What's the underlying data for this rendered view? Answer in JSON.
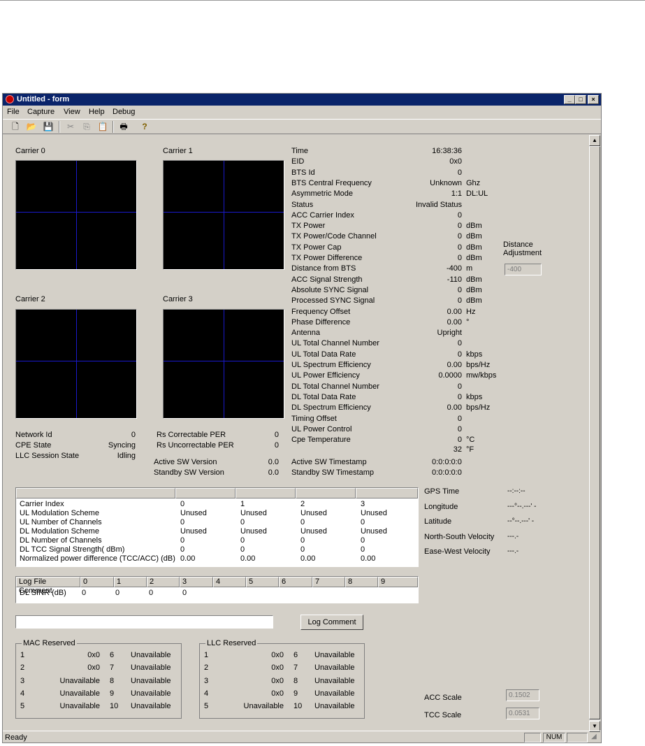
{
  "window": {
    "title": "Untitled - form",
    "min_glyph": "_",
    "max_glyph": "□",
    "close_glyph": "×"
  },
  "menu": {
    "items": [
      "File",
      "Capture",
      "View",
      "Help",
      "Debug"
    ]
  },
  "toolbar": {
    "icons": [
      "new-icon",
      "open-icon",
      "save-icon",
      "cut-icon",
      "copy-icon",
      "paste-icon",
      "print-icon",
      "help-icon"
    ],
    "glyphs": [
      "🗋",
      "📂",
      "💾",
      "✂",
      "⎘",
      "📋",
      "🖶",
      "?"
    ]
  },
  "carriers": [
    "Carrier 0",
    "Carrier 1",
    "Carrier 2",
    "Carrier 3"
  ],
  "left_info": [
    {
      "label": "Network Id",
      "value": "0"
    },
    {
      "label": "CPE State",
      "value": "Syncing"
    },
    {
      "label": "LLC Session State",
      "value": "Idling"
    }
  ],
  "mid_info": [
    {
      "label": "Rs Correctable PER",
      "value": "0"
    },
    {
      "label": "Rs Uncorrectable PER",
      "value": "0"
    }
  ],
  "sw": [
    {
      "label": "Active SW Version",
      "value": "0.0"
    },
    {
      "label": "Standby SW Version",
      "value": "0.0"
    }
  ],
  "stats": [
    {
      "label": "Time",
      "value": "16:38:36",
      "unit": ""
    },
    {
      "label": "EID",
      "value": "0x0",
      "unit": ""
    },
    {
      "label": "BTS Id",
      "value": "0",
      "unit": ""
    },
    {
      "label": "BTS Central Frequency",
      "value": "Unknown",
      "unit": "Ghz"
    },
    {
      "label": "Asymmetric Mode",
      "value": "1:1",
      "unit": "DL:UL"
    },
    {
      "label": "Status",
      "value": "Invalid Status",
      "unit": ""
    },
    {
      "label": "ACC Carrier Index",
      "value": "0",
      "unit": ""
    },
    {
      "label": "TX Power",
      "value": "0",
      "unit": "dBm"
    },
    {
      "label": "TX Power/Code Channel",
      "value": "0",
      "unit": "dBm"
    },
    {
      "label": "TX Power Cap",
      "value": "0",
      "unit": "dBm"
    },
    {
      "label": "TX Power Difference",
      "value": "0",
      "unit": "dBm"
    },
    {
      "label": "Distance from BTS",
      "value": "-400",
      "unit": "m"
    },
    {
      "label": "ACC Signal Strength",
      "value": "-110",
      "unit": "dBm"
    },
    {
      "label": "Absolute SYNC Signal",
      "value": "0",
      "unit": "dBm"
    },
    {
      "label": "Processed SYNC Signal",
      "value": "0",
      "unit": "dBm"
    },
    {
      "label": "Frequency Offset",
      "value": "0.00",
      "unit": "Hz"
    },
    {
      "label": "Phase Difference",
      "value": "0.00",
      "unit": "°"
    },
    {
      "label": "Antenna",
      "value": "Upright",
      "unit": ""
    },
    {
      "label": "UL Total Channel Number",
      "value": "0",
      "unit": ""
    },
    {
      "label": "UL Total Data Rate",
      "value": "0",
      "unit": "kbps"
    },
    {
      "label": "UL Spectrum Efficiency",
      "value": "0.00",
      "unit": "bps/Hz"
    },
    {
      "label": "UL Power Efficiency",
      "value": "0.0000",
      "unit": "mw/kbps"
    },
    {
      "label": "DL Total Channel Number",
      "value": "0",
      "unit": ""
    },
    {
      "label": "DL Total Data Rate",
      "value": "0",
      "unit": "kbps"
    },
    {
      "label": "DL Spectrum Efficiency",
      "value": "0.00",
      "unit": "bps/Hz"
    },
    {
      "label": "Timing Offset",
      "value": "0",
      "unit": ""
    },
    {
      "label": "UL Power Control",
      "value": "0",
      "unit": ""
    },
    {
      "label": "Cpe Temperature",
      "value": "0",
      "unit": "°C"
    }
  ],
  "temp_f": {
    "value": "32",
    "unit": "°F"
  },
  "timestamps": [
    {
      "label": "Active SW Timestamp",
      "value": "0:0:0:0:0"
    },
    {
      "label": "Standby SW Timestamp",
      "value": "0:0:0:0:0"
    }
  ],
  "distance_adjustment": {
    "label1": "Distance",
    "label2": "Adjustment",
    "value": "-400"
  },
  "carrier_table": {
    "rows": [
      {
        "label": "Carrier Index",
        "cells": [
          "0",
          "1",
          "2",
          "3"
        ]
      },
      {
        "label": "UL Modulation Scheme",
        "cells": [
          "Unused",
          "Unused",
          "Unused",
          "Unused"
        ]
      },
      {
        "label": "UL Number of Channels",
        "cells": [
          "0",
          "0",
          "0",
          "0"
        ]
      },
      {
        "label": "DL Modulation Scheme",
        "cells": [
          "Unused",
          "Unused",
          "Unused",
          "Unused"
        ]
      },
      {
        "label": "DL Number of Channels",
        "cells": [
          "0",
          "0",
          "0",
          "0"
        ]
      },
      {
        "label": "DL TCC Signal Strength( dBm)",
        "cells": [
          "0",
          "0",
          "0",
          "0"
        ]
      },
      {
        "label": "Normalized power difference (TCC/ACC) (dB)",
        "cells": [
          "0.00",
          "0.00",
          "0.00",
          "0.00"
        ]
      }
    ]
  },
  "gps": [
    {
      "label": "GPS Time",
      "value": "--:--:--"
    },
    {
      "label": "Longitude",
      "value": "---°--.---' -"
    },
    {
      "label": "Latitude",
      "value": "--°--.---' -"
    },
    {
      "label": "North-South Velocity",
      "value": "---.-"
    },
    {
      "label": "Ease-West Velocity",
      "value": "---.-"
    }
  ],
  "sinr_table": {
    "head_label": "Log File Comment",
    "head_cols": [
      "0",
      "1",
      "2",
      "3",
      "4",
      "5",
      "6",
      "7",
      "8",
      "9"
    ],
    "row_label": "DL SINR (dB)",
    "row_vals": [
      "0",
      "0",
      "0",
      "0"
    ]
  },
  "log": {
    "input_value": "",
    "button_label": "Log Comment"
  },
  "mac_reserved": {
    "title": "MAC Reserved",
    "rows": [
      {
        "a": "1",
        "av": "0x0",
        "b": "6",
        "bv": "Unavailable"
      },
      {
        "a": "2",
        "av": "0x0",
        "b": "7",
        "bv": "Unavailable"
      },
      {
        "a": "3",
        "av": "Unavailable",
        "b": "8",
        "bv": "Unavailable"
      },
      {
        "a": "4",
        "av": "Unavailable",
        "b": "9",
        "bv": "Unavailable"
      },
      {
        "a": "5",
        "av": "Unavailable",
        "b": "10",
        "bv": "Unavailable"
      }
    ]
  },
  "llc_reserved": {
    "title": "LLC Reserved",
    "rows": [
      {
        "a": "1",
        "av": "0x0",
        "b": "6",
        "bv": "Unavailable"
      },
      {
        "a": "2",
        "av": "0x0",
        "b": "7",
        "bv": "Unavailable"
      },
      {
        "a": "3",
        "av": "0x0",
        "b": "8",
        "bv": "Unavailable"
      },
      {
        "a": "4",
        "av": "0x0",
        "b": "9",
        "bv": "Unavailable"
      },
      {
        "a": "5",
        "av": "Unavailable",
        "b": "10",
        "bv": "Unavailable"
      }
    ]
  },
  "scales": [
    {
      "label": "ACC Scale",
      "value": "0.1502"
    },
    {
      "label": "TCC Scale",
      "value": "0.0531"
    }
  ],
  "scrollbar": {
    "up_glyph": "▲",
    "down_glyph": "▼"
  },
  "statusbar": {
    "text": "Ready",
    "num": "NUM"
  }
}
